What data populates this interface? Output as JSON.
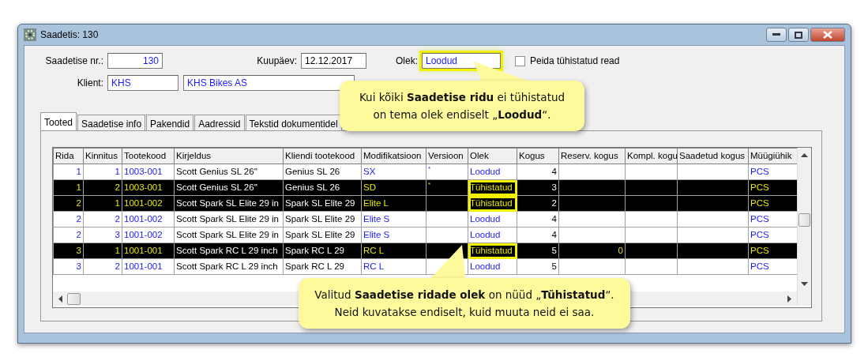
{
  "window": {
    "title": "Saadetis: 130"
  },
  "header": {
    "shipment_no": {
      "label": "Saadetise nr.:",
      "value": "130"
    },
    "date": {
      "label": "Kuupäev:",
      "value": "12.12.2017"
    },
    "status": {
      "label": "Olek:",
      "value": "Loodud",
      "highlighted": true
    },
    "hide_cancelled": {
      "label": "Peida tühistatud read",
      "checked": false
    },
    "client": {
      "label": "Klient:",
      "code": "KHS",
      "name": "KHS Bikes AS"
    }
  },
  "tabs": [
    {
      "label": "Tooted",
      "selected": true
    },
    {
      "label": "Saadetise info",
      "selected": false
    },
    {
      "label": "Pakendid",
      "selected": false
    },
    {
      "label": "Aadressid",
      "selected": false
    },
    {
      "label": "Tekstid dokumentidel",
      "selected": false
    }
  ],
  "grid": {
    "columns": [
      "Rida",
      "Kinnitus",
      "Tootekood",
      "Kirjeldus",
      "Kliendi tootekood",
      "Modifikatsioon",
      "Versioon",
      "Olek",
      "Kogus",
      "Reserv. kogus",
      "Kompl. kogu",
      "Saadetud kogus",
      "Müügiühik"
    ],
    "rows": [
      {
        "selected": false,
        "highlighted": false,
        "cells": [
          "1",
          "1",
          "1003-001",
          "Scott Genius SL 26''",
          "Genius SL 26",
          "SX",
          "*",
          "Loodud",
          "4",
          null,
          null,
          null,
          "PCS"
        ]
      },
      {
        "selected": true,
        "highlighted": true,
        "cells": [
          "1",
          "2",
          "1003-001",
          "Scott Genius SL 26''",
          "Genius SL 26",
          "SD",
          "*",
          "Tühistatud",
          "3",
          null,
          null,
          null,
          "PCS"
        ]
      },
      {
        "selected": true,
        "highlighted": true,
        "cells": [
          "2",
          "1",
          "1001-002",
          "Scott Spark SL Elite 29 in",
          "Spark SL Elite 29",
          "Elite L",
          null,
          "Tühistatud",
          "2",
          null,
          null,
          null,
          "PCS"
        ]
      },
      {
        "selected": false,
        "highlighted": false,
        "cells": [
          "2",
          "2",
          "1001-002",
          "Scott Spark SL Elite 29 in",
          "Spark SL Elite 29",
          "Elite S",
          null,
          "Loodud",
          "4",
          null,
          null,
          null,
          "PCS"
        ]
      },
      {
        "selected": false,
        "highlighted": false,
        "cells": [
          "2",
          "3",
          "1001-002",
          "Scott Spark SL Elite 29 in",
          "Spark SL Elite 29",
          "Elite S",
          null,
          "Loodud",
          "4",
          null,
          null,
          null,
          "PCS"
        ]
      },
      {
        "selected": true,
        "highlighted": true,
        "cells": [
          "3",
          "1",
          "1001-001",
          "Scott Spark RC L 29 inch",
          "Spark RC L 29",
          "RC L",
          null,
          "Tühistatud",
          "5",
          "0",
          null,
          null,
          "PCS"
        ]
      },
      {
        "selected": false,
        "highlighted": false,
        "cells": [
          "3",
          "2",
          "1001-001",
          "Scott Spark RC L 29 inch",
          "Spark RC L 29",
          "RC L",
          null,
          "Loodud",
          "5",
          null,
          null,
          null,
          "PCS"
        ]
      }
    ]
  },
  "callouts": [
    {
      "lines": [
        "Kui kõiki **Saadetise ridu** ei tühistatud",
        "on tema olek endiselt „**Loodud**“."
      ]
    },
    {
      "lines": [
        "Valitud **Saadetise ridade olek** on nüüd „**Tühistatud**“.",
        "Neid kuvatakse endiselt, kuid muuta neid ei saa."
      ]
    }
  ]
}
